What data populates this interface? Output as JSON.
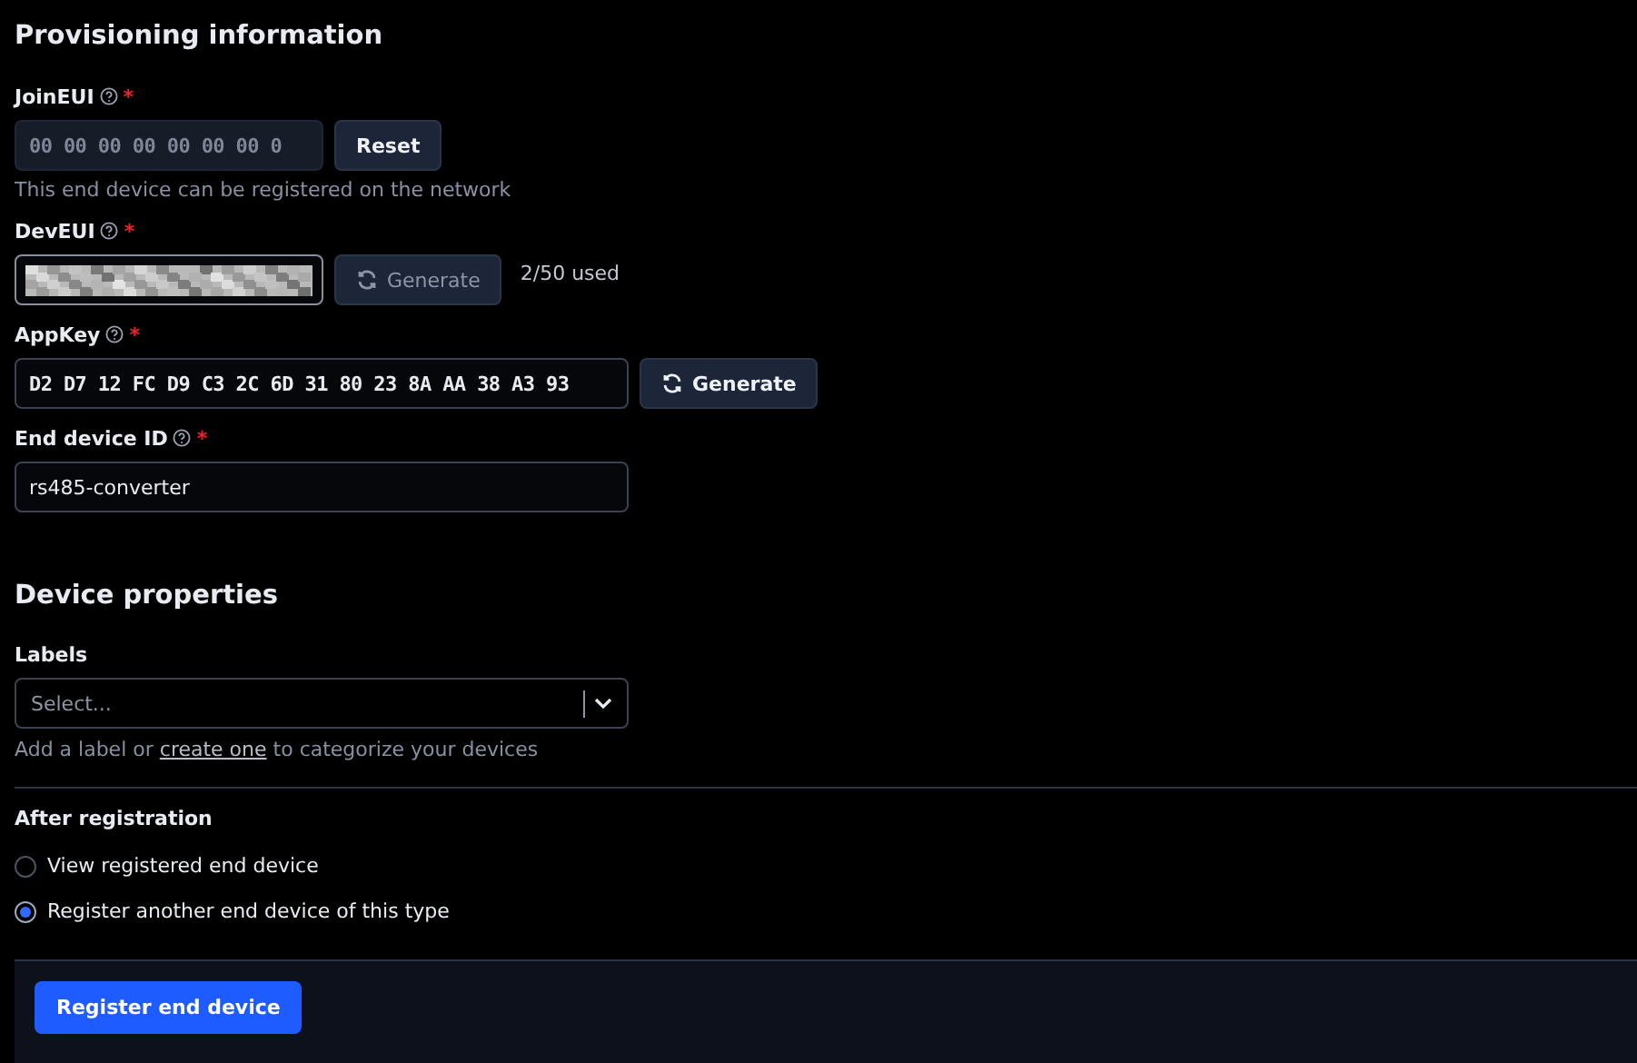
{
  "provisioning": {
    "heading": "Provisioning information",
    "fields": [
      {
        "label": "JoinEUI",
        "help_icon": true,
        "required_mark": "*",
        "kind": "text",
        "mono": true,
        "value": "00 00 00 00 00 00 00 0",
        "disabled": true,
        "button": {
          "label": "Reset",
          "icon": false,
          "disabled": false
        },
        "hint": "This end device can be registered on the network"
      },
      {
        "label": "DevEUI",
        "help_icon": true,
        "required_mark": "*",
        "kind": "redacted",
        "button": {
          "label": "Generate",
          "icon": true,
          "disabled": true
        },
        "note": "2/50 used"
      },
      {
        "label": "AppKey",
        "help_icon": true,
        "required_mark": "*",
        "kind": "text",
        "mono": true,
        "value": "D2 D7 12 FC D9 C3 2C 6D 31 80 23 8A AA 38 A3 93",
        "disabled": false,
        "button": {
          "label": "Generate",
          "icon": true,
          "disabled": false
        }
      },
      {
        "label": "End device ID",
        "help_icon": true,
        "required_mark": "*",
        "kind": "text",
        "mono": false,
        "value": "rs485-converter",
        "disabled": false
      }
    ]
  },
  "device_properties": {
    "heading": "Device properties",
    "labels": {
      "label": "Labels",
      "placeholder": "Select...",
      "hint_before": "Add a label or",
      "hint_link": "create one",
      "hint_after": "to categorize your devices"
    }
  },
  "after_registration": {
    "label": "After registration",
    "options": [
      {
        "label": "View registered end device",
        "selected": false
      },
      {
        "label": "Register another end device of this type",
        "selected": true
      }
    ]
  },
  "submit_button": "Register end device"
}
